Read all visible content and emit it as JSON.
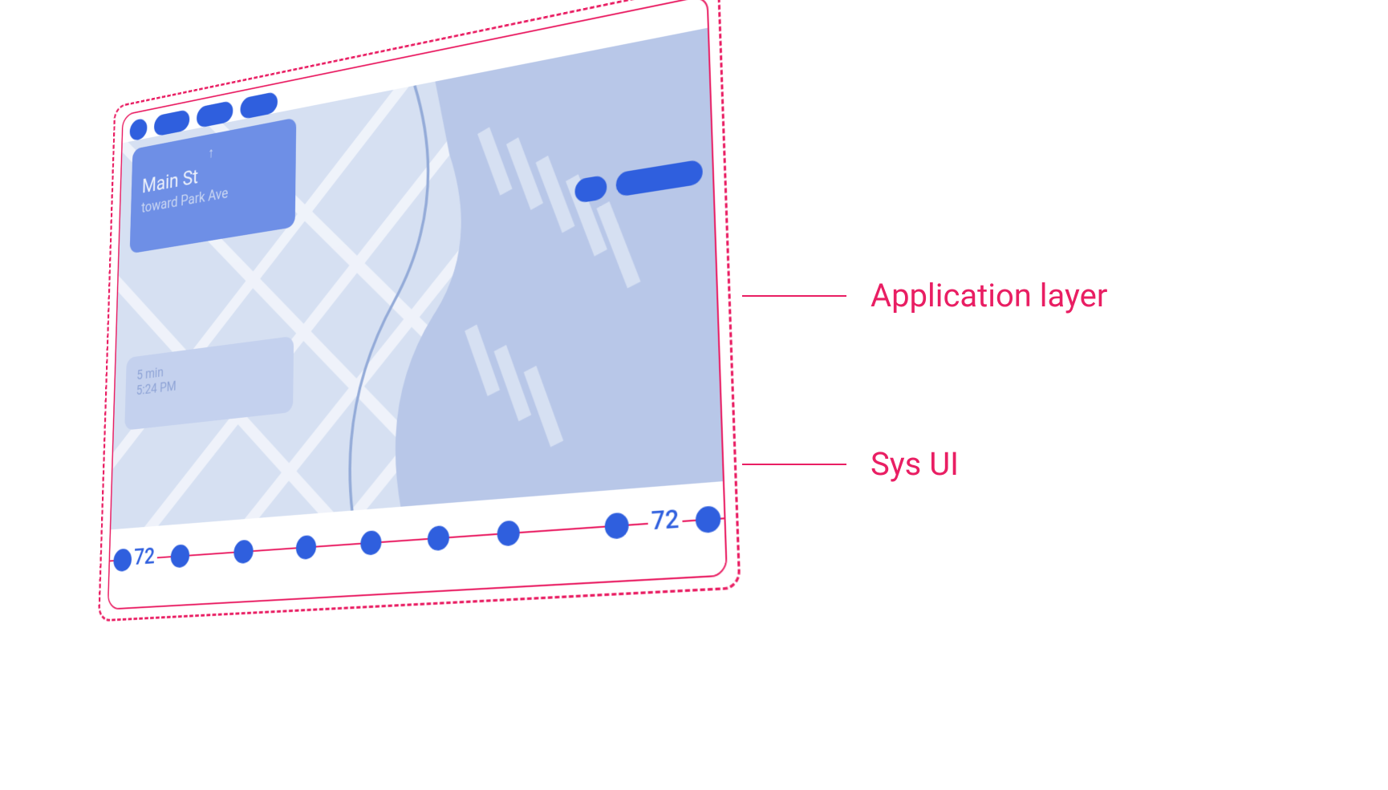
{
  "callouts": {
    "applicationLayer": "Application layer",
    "sysUi": "Sys UI"
  },
  "navigation": {
    "direction_icon": "up-arrow-icon",
    "street": "Main St",
    "toward": "toward Park Ave"
  },
  "eta": {
    "duration": "5 min",
    "arrival": "5:24 PM"
  },
  "measurements": {
    "bottomBarHeight": "72",
    "bottomBarHeightRight": "72"
  },
  "colors": {
    "accent": "#E91E63",
    "primary": "#2F5FDE",
    "mapBg": "#D6E0F2",
    "cardPrimary": "#6E8FE6",
    "cardSecondary": "#C4D1EE"
  }
}
